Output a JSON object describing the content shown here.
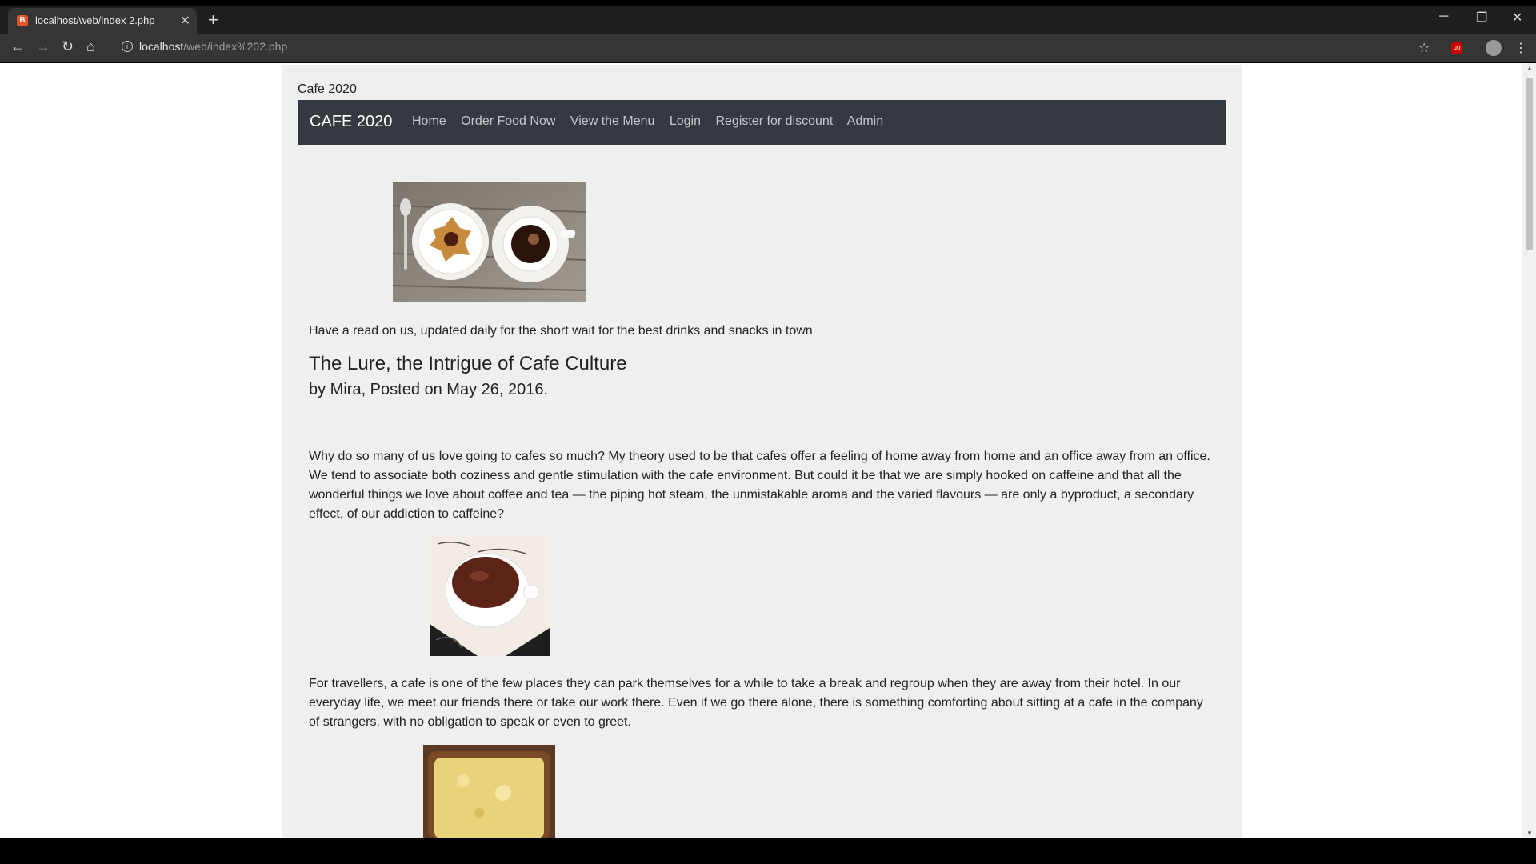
{
  "browser": {
    "tab_title": "localhost/web/index 2.php",
    "tab_close": "✕",
    "new_tab": "+",
    "url_host": "localhost",
    "url_path": "/web/index%202.php",
    "window_minimize": "─",
    "window_restore": "❐",
    "window_close": "✕"
  },
  "site": {
    "title": "Cafe 2020",
    "nav": {
      "brand": "CAFE 2020",
      "links": [
        "Home",
        "Order Food Now",
        "View the Menu",
        "Login",
        "Register for discount",
        "Admin"
      ]
    },
    "tagline": "Have a read on us, updated daily for the short wait for the best drinks and snacks in town",
    "article": {
      "title": "The Lure, the Intrigue of Cafe Culture",
      "byline": "by Mira, Posted on May 26, 2016.",
      "paragraphs": [
        "Why do so many of us love going to cafes so much? My theory used to be that cafes offer a feeling of home away from home and an office away from an office. We tend to associate both coziness and gentle stimulation with the cafe environment. But could it be that we are simply hooked on caffeine and that all the wonderful things we love about coffee and tea — the piping hot steam, the unmistakable aroma and the varied flavours — are only a byproduct, a secondary effect, of our addiction to caffeine?",
        "For travellers, a cafe is one of the few places they can park themselves for a while to take a break and regroup when they are away from their hotel. In our everyday life, we meet our friends there or take our work there. Even if we go there alone, there is something comforting about sitting at a cafe in the company of strangers, with no obligation to speak or even to greet."
      ]
    }
  },
  "colors": {
    "navbar_bg": "#343a40",
    "page_bg": "#efefef"
  }
}
